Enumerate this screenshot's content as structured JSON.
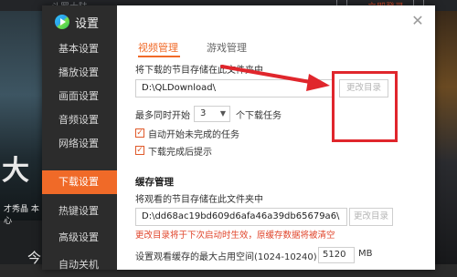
{
  "background": {
    "title": "斗罗大陆",
    "login": "立即登录",
    "poster_text": "大",
    "poster_sub": "才秀晶 本心",
    "bottom_text": "今日"
  },
  "dialog": {
    "title": "设置",
    "close_icon": "close-icon",
    "sidebar": {
      "items": [
        {
          "label": "基本设置"
        },
        {
          "label": "播放设置"
        },
        {
          "label": "画面设置"
        },
        {
          "label": "音频设置"
        },
        {
          "label": "网络设置"
        },
        {
          "label": "下载设置",
          "active": true
        },
        {
          "label": "热键设置"
        },
        {
          "label": "高级设置"
        },
        {
          "label": "自动关机"
        }
      ]
    },
    "tabs": [
      {
        "label": "视频管理",
        "active": true
      },
      {
        "label": "游戏管理"
      }
    ],
    "download": {
      "save_label": "将下载的节目存储在此文件夹中",
      "path": "D:\\QLDownload\\",
      "change_dir": "更改目录",
      "max_label": "最多同时开始",
      "max_value": "3",
      "max_suffix": "个下载任务",
      "auto_start": "自动开始未完成的任务",
      "notify": "下载完成后提示"
    },
    "cache": {
      "title": "缓存管理",
      "save_label": "将观看的节目存储在此文件夹中",
      "path": "D:\\dd68ac19bd609d6afa46a39db65679a6\\",
      "change_dir": "更改目录",
      "warning": "更改目录将于下次启动时生效，原缓存数据将被清空",
      "size_label": "设置观看缓存的最大占用空间(1024-10240)",
      "size_value": "5120",
      "size_unit": "MB"
    }
  },
  "colors": {
    "accent": "#f06a28",
    "annotation": "#e0262c",
    "sidebar_bg": "#2c2c2c"
  }
}
